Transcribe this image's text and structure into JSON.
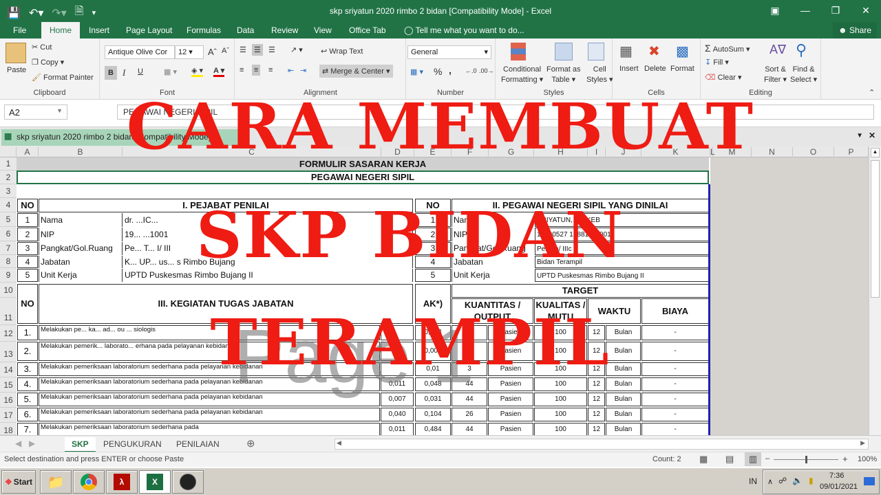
{
  "window": {
    "title": "skp sriyatun 2020 rimbo 2 bidan  [Compatibility Mode] - Excel",
    "controls": [
      "restore-ribbon-icon",
      "minimize-icon",
      "maximize-icon",
      "close-icon"
    ]
  },
  "quick_access": [
    "save-icon",
    "undo-icon",
    "redo-icon",
    "print-preview-icon",
    "customize-icon"
  ],
  "menu_tabs": [
    "File",
    "Home",
    "Insert",
    "Page Layout",
    "Formulas",
    "Data",
    "Review",
    "View",
    "Office Tab"
  ],
  "active_tab": "Home",
  "tell_me": "Tell me what you want to do...",
  "share": "Share",
  "ribbon": {
    "clipboard": {
      "label": "Clipboard",
      "paste": "Paste",
      "cut": "Cut",
      "copy": "Copy",
      "format_painter": "Format Painter"
    },
    "font": {
      "label": "Font",
      "font_name": "Antique Olive Cor",
      "font_size": "12",
      "bold": "B",
      "italic": "I",
      "underline": "U"
    },
    "alignment": {
      "label": "Alignment",
      "wrap_text": "Wrap Text",
      "merge_center": "Merge & Center"
    },
    "number": {
      "label": "Number",
      "format": "General",
      "percent": "%",
      "comma": ","
    },
    "styles": {
      "label": "Styles",
      "conditional": "Conditional",
      "conditional2": "Formatting",
      "format_table": "Format as",
      "format_table2": "Table",
      "cell_styles": "Cell",
      "cell_styles2": "Styles"
    },
    "cells": {
      "label": "Cells",
      "insert": "Insert",
      "delete": "Delete",
      "format": "Format"
    },
    "editing": {
      "label": "Editing",
      "autosum": "AutoSum",
      "fill": "Fill",
      "clear": "Clear",
      "sort": "Sort &",
      "sort2": "Filter",
      "find": "Find &",
      "find2": "Select"
    }
  },
  "formula_bar": {
    "name_box": "A2",
    "content": "PEGAWAI NEGERI SIPIL"
  },
  "doc_tab": "skp sriyatun 2020 rimbo 2 bidan  [Compatibility Mode] *",
  "columns": [
    "A",
    "B",
    "C",
    "D",
    "E",
    "F",
    "G",
    "H",
    "I",
    "J",
    "K",
    "L",
    "M",
    "N",
    "O",
    "P"
  ],
  "rows": [
    "1",
    "2",
    "3",
    "4",
    "5",
    "6",
    "7",
    "8",
    "9",
    "10",
    "11",
    "12",
    "13",
    "14",
    "15",
    "16",
    "17",
    "18"
  ],
  "sheet": {
    "title1": "FORMULIR SASARAN KERJA",
    "title2": "PEGAWAI NEGERI SIPIL",
    "no": "NO",
    "section1": "I. PEJABAT PENILAI",
    "section2": "II. PEGAWAI NEGERI SIPIL YANG DINILAI",
    "pejabat": [
      {
        "no": "1",
        "label": "Nama",
        "value": "dr. ...IC..."
      },
      {
        "no": "2",
        "label": "NIP",
        "value": "19... ...1001"
      },
      {
        "no": "3",
        "label": "Pangkat/Gol.Ruang",
        "value": "Pe... T... I/ III"
      },
      {
        "no": "4",
        "label": "Jabatan",
        "value": "K... UP... us... s Rimbo Bujang"
      },
      {
        "no": "5",
        "label": "Unit Kerja",
        "value": "UPTD Puskesmas Rimbo Bujang II"
      }
    ],
    "pegawai": [
      {
        "no": "1",
        "label": "Nama",
        "value": "SRIYATUN, AM.KEB"
      },
      {
        "no": "2",
        "label": "NIP",
        "value": "19690527 198811 2 001"
      },
      {
        "no": "3",
        "label": "Pangkat/Gol.Ruang",
        "value": "Penata/ IIIc"
      },
      {
        "no": "4",
        "label": "Jabatan",
        "value": "Bidan Terampil"
      },
      {
        "no": "5",
        "label": "Unit Kerja",
        "value": "UPTD Puskesmas Rimbo Bujang II"
      }
    ],
    "section3": "III. KEGIATAN TUGAS JABATAN",
    "ak": "AK*)",
    "target": "TARGET",
    "kuantitas": "KUANTITAS / OUTPUT",
    "kualitas": "KUALITAS / MUTU",
    "waktu": "WAKTU",
    "biaya": "BIAYA",
    "activities": [
      {
        "no": "1.",
        "text": "Melakukan pe... ka... ad... ou ... siologis",
        "ak1": "",
        "ak2": "0,003",
        "qty": "30",
        "unit": "Pasien",
        "mutu": "100",
        "waktu": "12",
        "wunit": "Bulan",
        "biaya": "-"
      },
      {
        "no": "2.",
        "text": "Melakukan pemerik... laborato... erhana pada pelayanan kebidanan",
        "ak1": "",
        "ak2": "0,005",
        "qty": "50",
        "unit": "Pasien",
        "mutu": "100",
        "waktu": "12",
        "wunit": "Bulan",
        "biaya": "-"
      },
      {
        "no": "3.",
        "text": "Melakukan pemeriksaan laboratorium sederhana pada pelayanan kebidanan",
        "ak1": "",
        "ak2": "0,01",
        "qty": "3",
        "unit": "Pasien",
        "mutu": "100",
        "waktu": "12",
        "wunit": "Bulan",
        "biaya": "-"
      },
      {
        "no": "4.",
        "text": "Melakukan pemeriksaan laboratorium sederhana pada pelayanan kebidanan",
        "ak1": "0,011",
        "ak2": "0,048",
        "qty": "44",
        "unit": "Pasien",
        "mutu": "100",
        "waktu": "12",
        "wunit": "Bulan",
        "biaya": "-"
      },
      {
        "no": "5.",
        "text": "Melakukan pemeriksaan laboratorium sederhana pada pelayanan kebidanan",
        "ak1": "0,007",
        "ak2": "0,031",
        "qty": "44",
        "unit": "Pasien",
        "mutu": "100",
        "waktu": "12",
        "wunit": "Bulan",
        "biaya": "-"
      },
      {
        "no": "6.",
        "text": "Melakukan pemeriksaan laboratorium sederhana pada pelayanan kebidanan",
        "ak1": "0,040",
        "ak2": "0,104",
        "qty": "26",
        "unit": "Pasien",
        "mutu": "100",
        "waktu": "12",
        "wunit": "Bulan",
        "biaya": "-"
      },
      {
        "no": "7.",
        "text": "Melakukan pemeriksaan laboratorium sederhana pada",
        "ak1": "0,011",
        "ak2": "0,484",
        "qty": "44",
        "unit": "Pasien",
        "mutu": "100",
        "waktu": "12",
        "wunit": "Bulan",
        "biaya": "-"
      }
    ]
  },
  "watermark": "Page 1",
  "sheet_tabs": [
    "SKP",
    "PENGUKURAN",
    "PENILAIAN"
  ],
  "active_sheet": "SKP",
  "status": {
    "message": "Select destination and press ENTER or choose Paste",
    "count": "Count: 2",
    "zoom": "100%",
    "zoom_level_percent": 100
  },
  "overlay": {
    "line1": "CARA MEMBUAT",
    "line2": "SKP BIDAN",
    "line3": "TERAMPIL",
    "color": "#ee1c13"
  },
  "taskbar": {
    "start": "Start",
    "apps": [
      "file-explorer-icon",
      "chrome-icon",
      "adobe-reader-icon",
      "excel-icon",
      "obs-icon"
    ],
    "lang": "IN",
    "time": "7:36",
    "date": "09/01/2021"
  }
}
